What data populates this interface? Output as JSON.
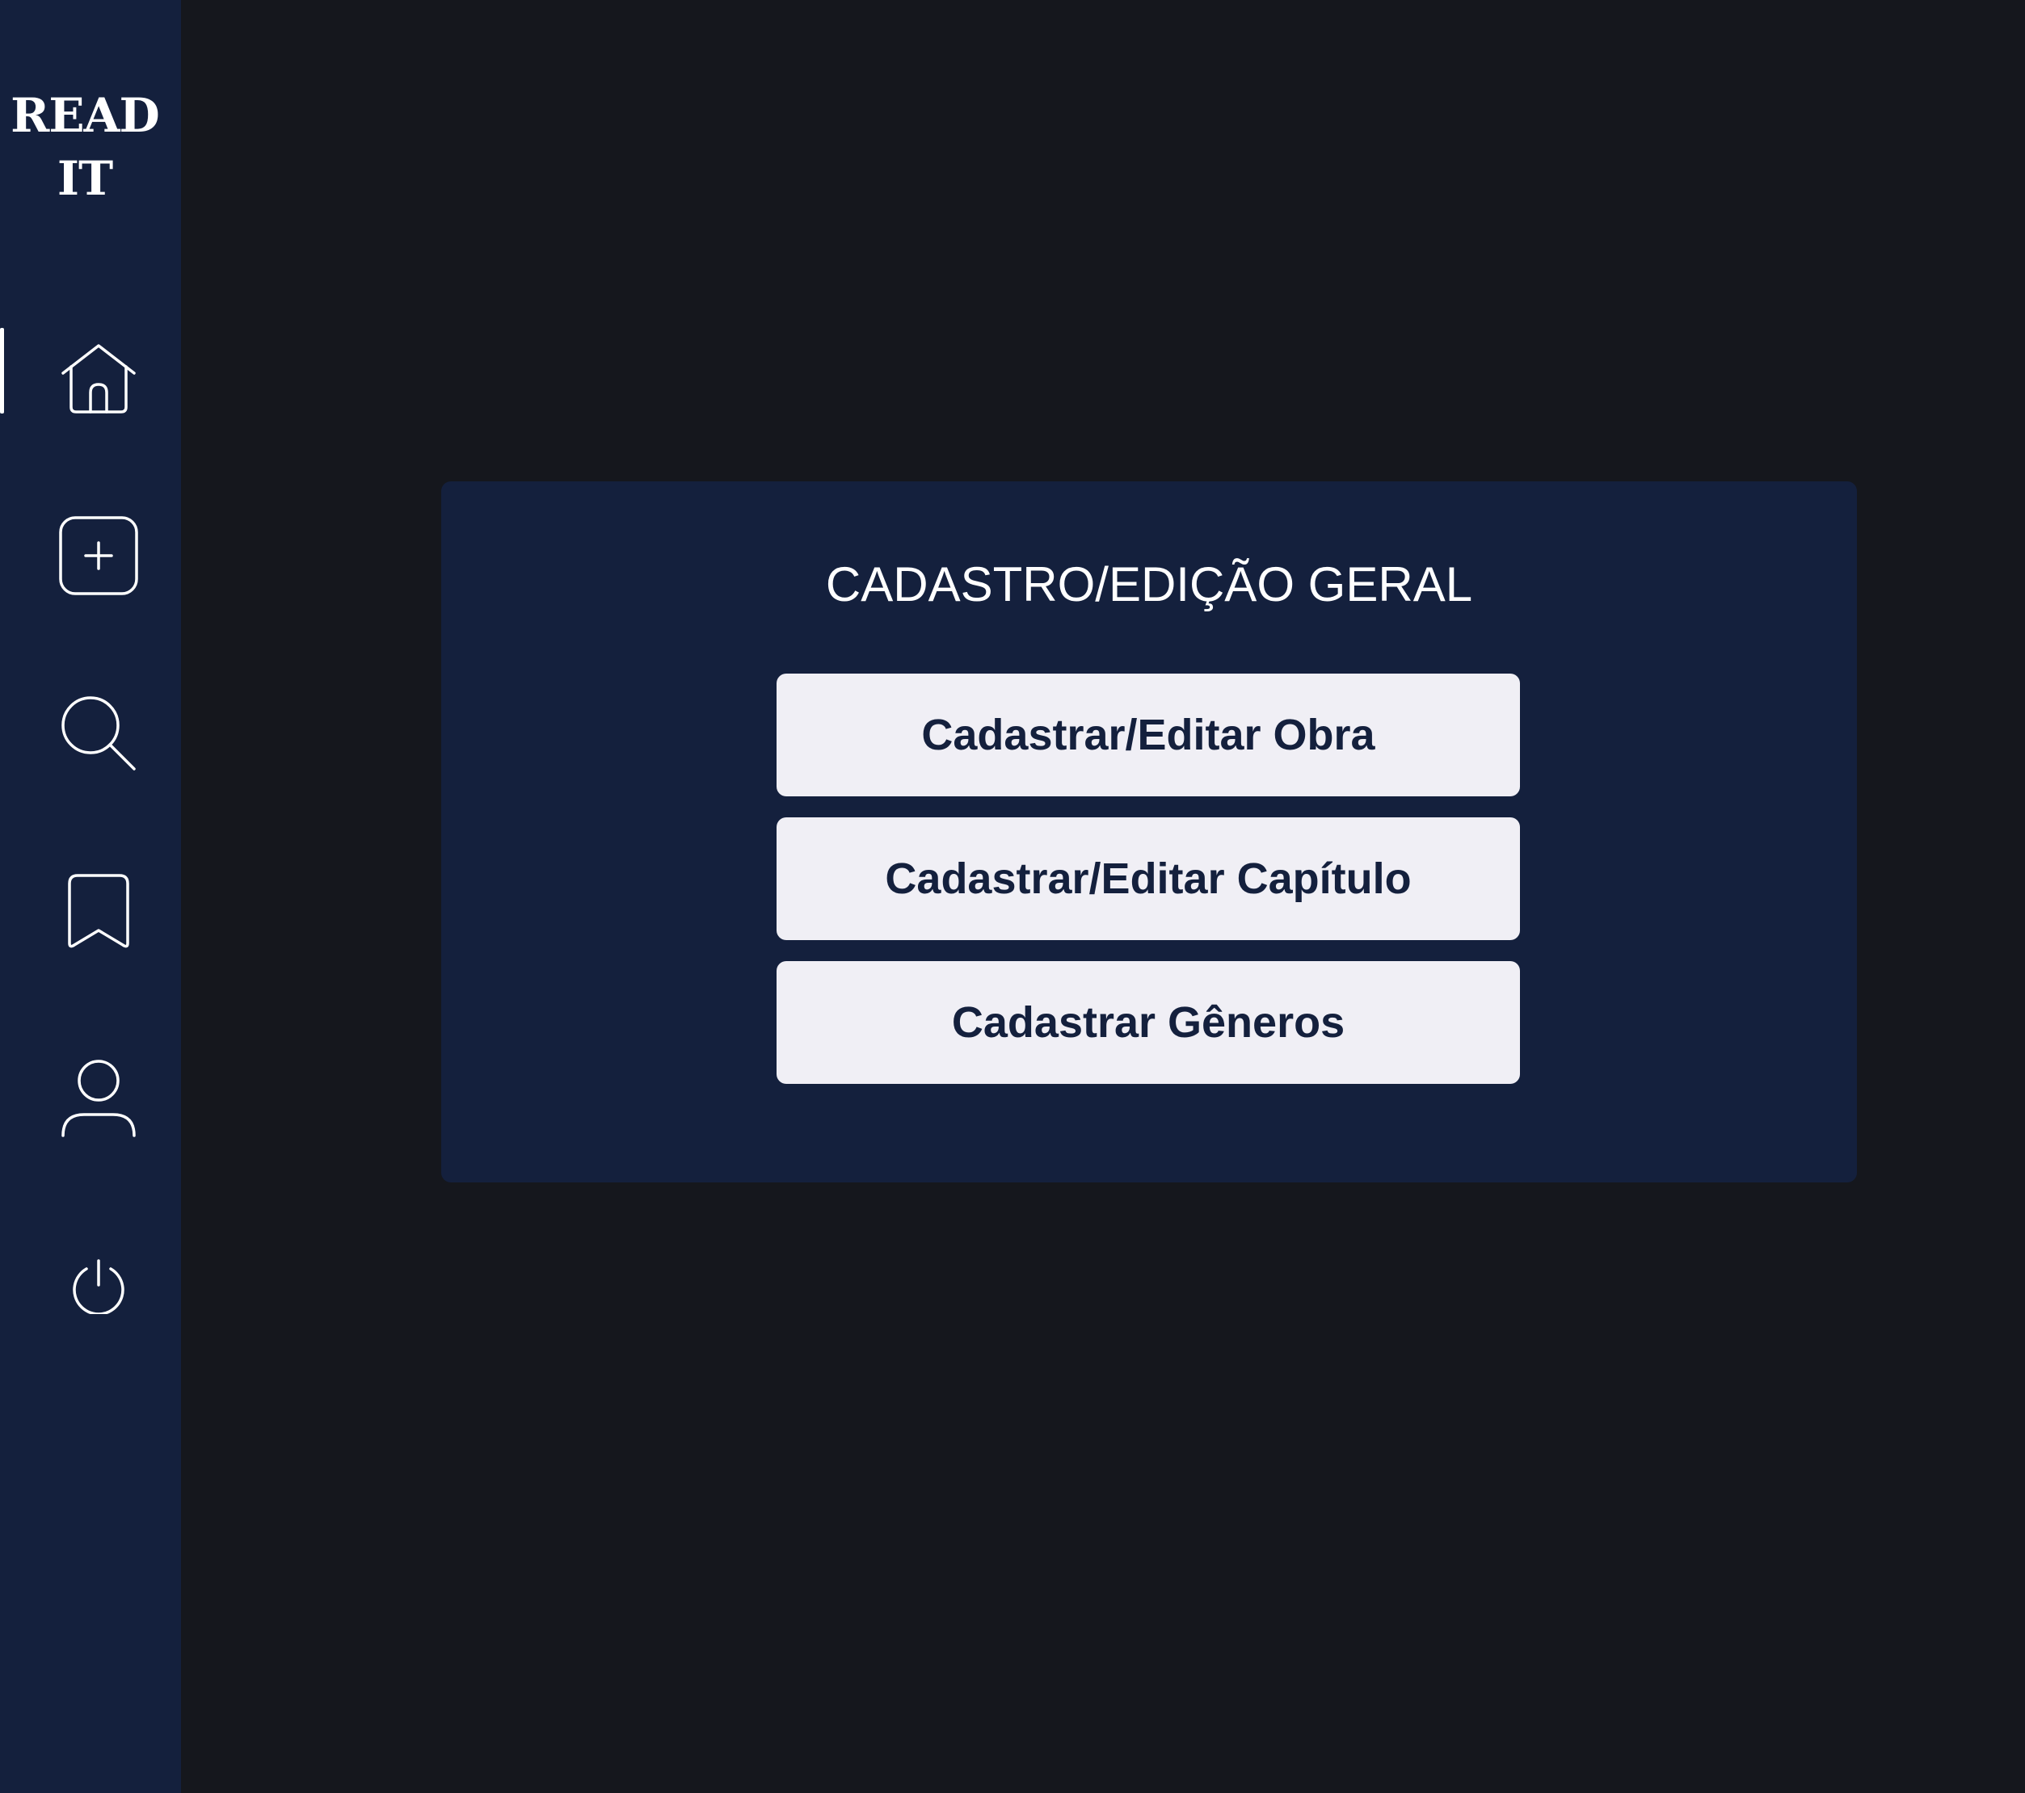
{
  "sidebar": {
    "logo_line1": "READ",
    "logo_line2": "IT",
    "items": [
      {
        "icon": "home-icon",
        "active": true
      },
      {
        "icon": "add-square-icon",
        "active": false
      },
      {
        "icon": "search-icon",
        "active": false
      },
      {
        "icon": "bookmark-icon",
        "active": false
      },
      {
        "icon": "user-icon",
        "active": false
      },
      {
        "icon": "power-icon",
        "active": false
      }
    ]
  },
  "main": {
    "card": {
      "title": "CADASTRO/EDIÇÃO GERAL",
      "buttons": [
        {
          "label": "Cadastrar/Editar Obra"
        },
        {
          "label": "Cadastrar/Editar Capítulo"
        },
        {
          "label": "Cadastrar Gêneros"
        }
      ]
    }
  },
  "colors": {
    "background": "#15171d",
    "sidebar": "#14203d",
    "card": "#14203d",
    "button_bg": "#f0eff5",
    "button_text": "#14203d",
    "icon": "#ffffff"
  }
}
